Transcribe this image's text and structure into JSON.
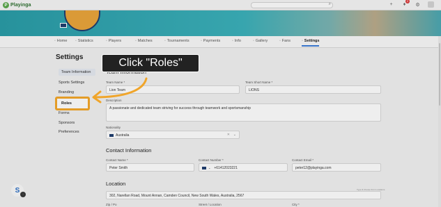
{
  "app": {
    "logo_text": "Playinga"
  },
  "topbar": {
    "notification_count": "2"
  },
  "tabs": [
    {
      "label": "Home",
      "icon": "home-icon"
    },
    {
      "label": "Statistics",
      "icon": "chart-icon"
    },
    {
      "label": "Players",
      "icon": "players-icon"
    },
    {
      "label": "Matches",
      "icon": "matches-icon"
    },
    {
      "label": "Tournaments",
      "icon": "trophy-icon"
    },
    {
      "label": "Payments",
      "icon": "payments-icon"
    },
    {
      "label": "Info",
      "icon": "info-icon"
    },
    {
      "label": "Gallery",
      "icon": "gallery-icon"
    },
    {
      "label": "Fans",
      "icon": "fans-icon"
    },
    {
      "label": "Settings",
      "icon": "gear-icon"
    }
  ],
  "settings": {
    "title": "Settings",
    "menu": [
      "Team Information",
      "Sports Settings",
      "Branding",
      "Roles",
      "Forms",
      "Sponsors",
      "Preferences"
    ],
    "active_item": "Team Information"
  },
  "callout": {
    "text": "Click \"Roles\""
  },
  "team_info": {
    "heading": "Team Information",
    "team_name_label": "Team Name *",
    "team_name_value": "Lion Team",
    "short_name_label": "Team Short Name *",
    "short_name_value": "LIONS",
    "description_label": "Description",
    "description_value": "A passionate and dedicated team striving for success through teamwork and sportsmanship",
    "nationality_label": "Nationality",
    "nationality_value": "Australia"
  },
  "contact": {
    "heading": "Contact Information",
    "name_label": "Contact Name *",
    "name_value": "Peter Smith",
    "number_label": "Contact Number *",
    "number_value": "+61412023221",
    "email_label": "Contact Email *",
    "email_value": "peter12@playinga.com"
  },
  "location": {
    "heading": "Location",
    "address_value": "302, Narellan Road, Mount Annan, Camden Council, New South Wales, Australia, 2567",
    "zip_label": "Zip / Po",
    "street_label": "Street / Location",
    "city_label": "City *",
    "note": "Type & choose from Locations"
  },
  "colors": {
    "accent": "#f0a52a",
    "banner": "#2a9aa5",
    "callout_bg": "#222222"
  }
}
